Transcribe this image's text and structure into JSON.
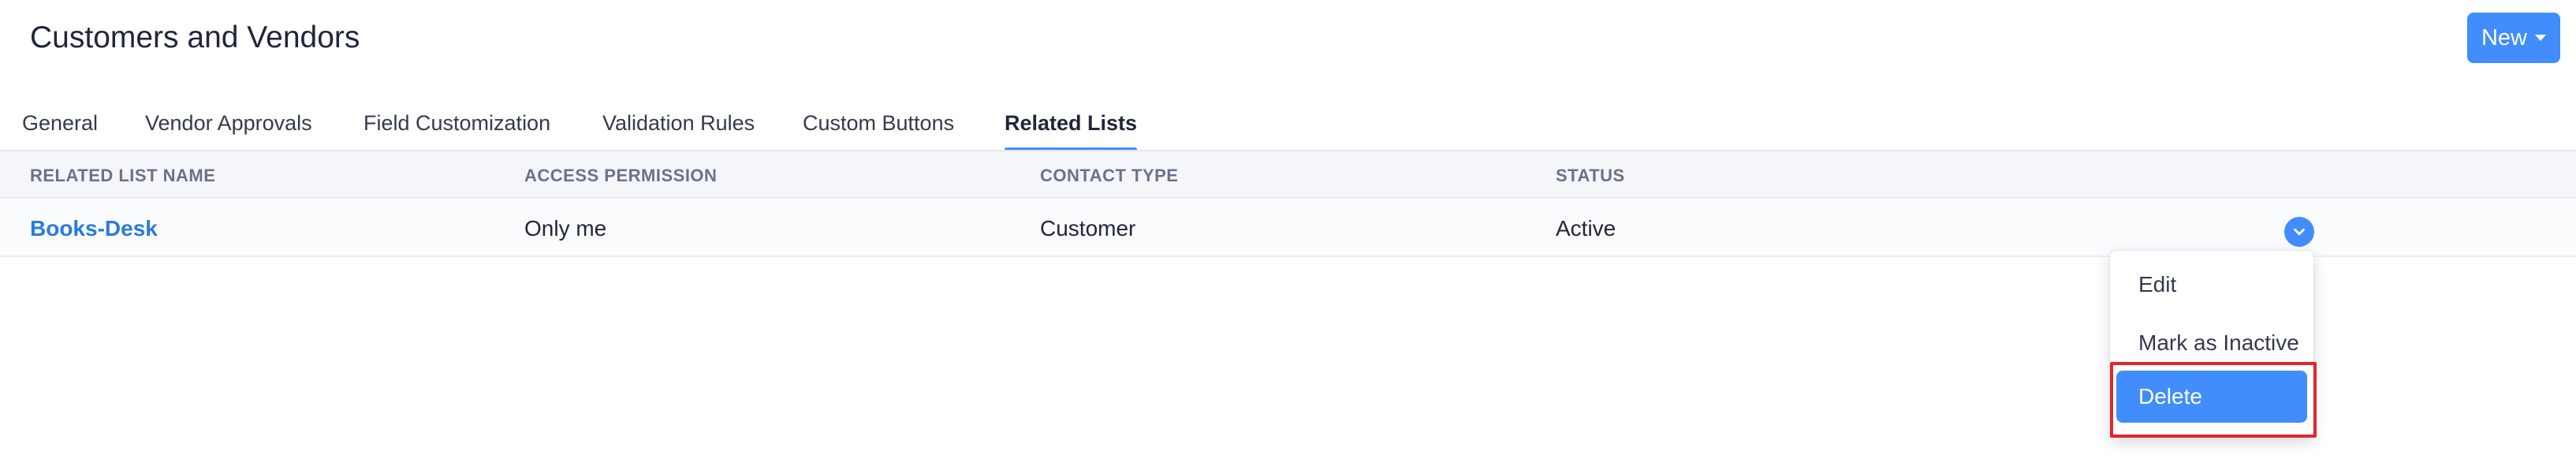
{
  "header": {
    "title": "Customers and Vendors",
    "new_button_label": "New"
  },
  "tabs": [
    {
      "label": "General",
      "active": false
    },
    {
      "label": "Vendor Approvals",
      "active": false
    },
    {
      "label": "Field Customization",
      "active": false
    },
    {
      "label": "Validation Rules",
      "active": false
    },
    {
      "label": "Custom Buttons",
      "active": false
    },
    {
      "label": "Related Lists",
      "active": true
    }
  ],
  "table": {
    "columns": [
      "RELATED LIST NAME",
      "ACCESS PERMISSION",
      "CONTACT TYPE",
      "STATUS"
    ],
    "rows": [
      {
        "name": "Books-Desk",
        "access_permission": "Only me",
        "contact_type": "Customer",
        "status": "Active"
      }
    ]
  },
  "row_menu": {
    "items": [
      "Edit",
      "Mark as Inactive",
      "Delete"
    ],
    "highlighted_item": "Delete"
  },
  "colors": {
    "accent": "#408dfb",
    "link": "#2a7bdb",
    "highlight_border": "#e0262d"
  },
  "icons": {
    "new_button_caret": "caret-down-icon",
    "row_toggle": "chevron-down-icon"
  }
}
